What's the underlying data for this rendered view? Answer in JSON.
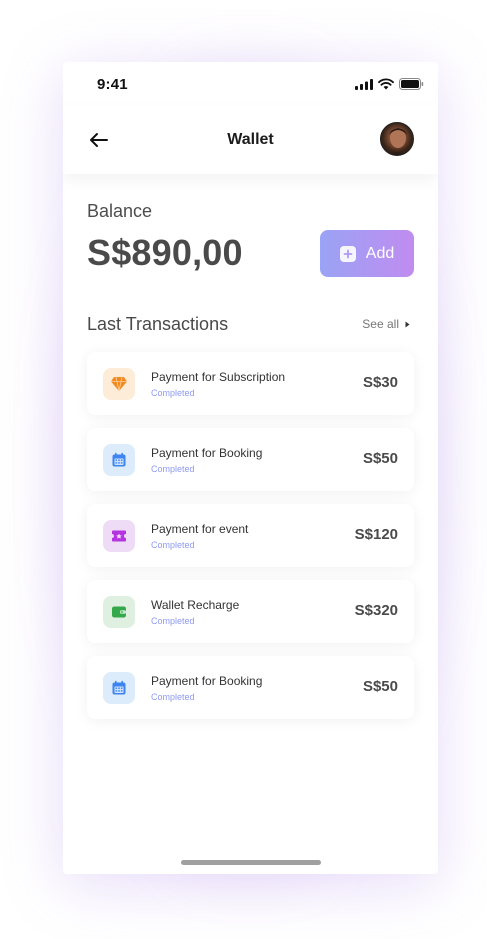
{
  "status_bar": {
    "time": "9:41"
  },
  "nav": {
    "title": "Wallet"
  },
  "balance": {
    "label": "Balance",
    "value": "S$890,00"
  },
  "add_button": {
    "label": "Add"
  },
  "transactions": {
    "title": "Last Transactions",
    "see_all": "See all",
    "items": [
      {
        "name": "Payment for Subscription",
        "status": "Completed",
        "amount": "S$30",
        "icon": "diamond-icon",
        "icon_bg": "#fdecd8",
        "icon_color": "#f28a1e"
      },
      {
        "name": "Payment for Booking",
        "status": "Completed",
        "amount": "S$50",
        "icon": "calendar-icon",
        "icon_bg": "#dcecfb",
        "icon_color": "#3d84f2"
      },
      {
        "name": "Payment for event",
        "status": "Completed",
        "amount": "S$120",
        "icon": "ticket-icon",
        "icon_bg": "#eedcf6",
        "icon_color": "#b534e0"
      },
      {
        "name": "Wallet Recharge",
        "status": "Completed",
        "amount": "S$320",
        "icon": "wallet-icon",
        "icon_bg": "#dff0e1",
        "icon_color": "#35a84a"
      },
      {
        "name": "Payment for Booking",
        "status": "Completed",
        "amount": "S$50",
        "icon": "calendar-icon",
        "icon_bg": "#dcecfb",
        "icon_color": "#3d84f2"
      }
    ]
  },
  "colors": {
    "accent_gradient_start": "#9aa3f5",
    "accent_gradient_end": "#c08cf0",
    "status_text": "#8e9bf0"
  }
}
